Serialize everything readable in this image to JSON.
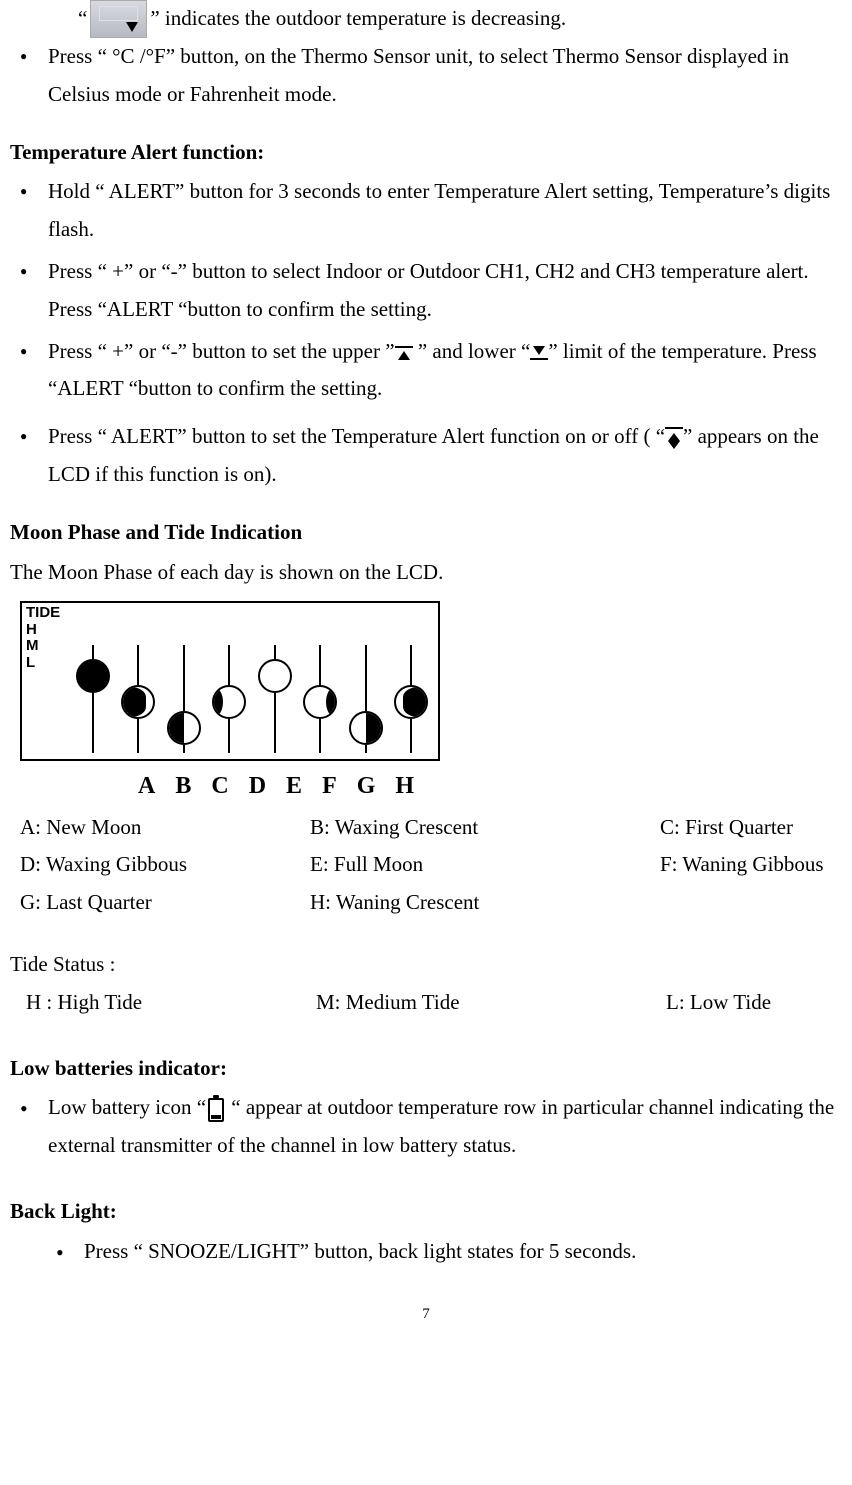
{
  "intro": {
    "quote_open": "“",
    "quote_close": "”",
    "line1_rest": " indicates the outdoor temperature is decreasing.",
    "bullet1": "Press “ °C /°F” button, on the Thermo Sensor unit, to select Thermo Sensor displayed in Celsius mode or Fahrenheit mode."
  },
  "temp_alert": {
    "heading": "Temperature Alert function:",
    "b1": "Hold “ ALERT” button for 3 seconds to enter Temperature Alert setting, Temperature’s digits flash.",
    "b2": "Press “ +” or “-” button to select Indoor or Outdoor CH1, CH2 and CH3 temperature alert. Press “ALERT “button to confirm the setting.",
    "b3_a": "Press “ +” or “-” button to set the upper ”",
    "b3_b": " ” and lower “",
    "b3_c": "” limit of the temperature. Press “ALERT “button to confirm the setting.",
    "b4_a": "Press “ ALERT” button to set the Temperature Alert function on or off ( “",
    "b4_b": "” appears on the LCD if this function is on)."
  },
  "moon": {
    "heading": "Moon Phase and Tide Indication",
    "desc": "The Moon Phase of each day is shown on the LCD.",
    "tide_box": {
      "tide": "TIDE",
      "h": "H",
      "m": "M",
      "l": "L"
    },
    "letters": [
      "A",
      "B",
      "C",
      "D",
      "E",
      "F",
      "G",
      "H"
    ],
    "legend": {
      "a": "A: New Moon",
      "b": "B: Waxing Crescent",
      "c": "C: First Quarter",
      "d": "D: Waxing Gibbous",
      "e": "E: Full Moon",
      "f": "F: Waning Gibbous",
      "g": "G: Last Quarter",
      "h": "H: Waning Crescent"
    }
  },
  "tide": {
    "heading": "Tide Status :",
    "h": "H : High Tide",
    "m": "M: Medium Tide",
    "l": "L: Low Tide"
  },
  "low_bat": {
    "heading": "Low batteries indicator:",
    "b1_a": "Low battery icon “",
    "b1_b": "  “ appear at outdoor temperature row in particular channel indicating the external transmitter of the channel in low battery status."
  },
  "backlight": {
    "heading": "Back Light:",
    "b1": "Press “ SNOOZE/LIGHT” button, back light states for 5 seconds."
  },
  "page": "7"
}
